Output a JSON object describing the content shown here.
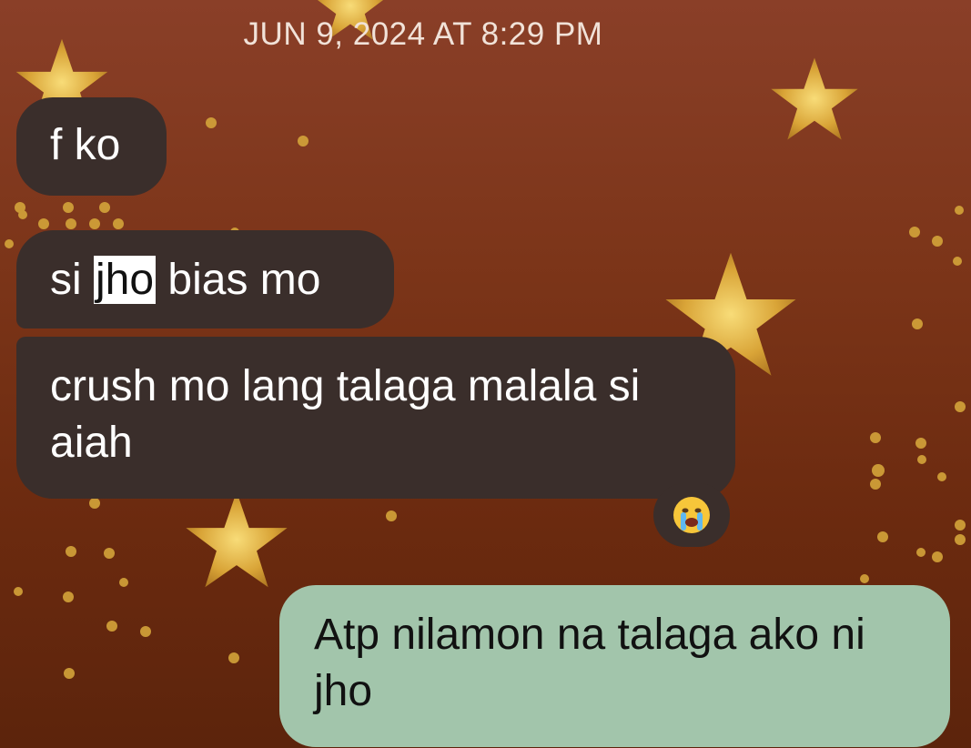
{
  "header": {
    "timestamp": "JUN 9, 2024 AT 8:29 PM"
  },
  "messages": [
    {
      "sender": "other",
      "parts": [
        "f ko"
      ]
    },
    {
      "sender": "other",
      "parts": [
        "si ",
        "jho",
        " bias mo"
      ],
      "highlighted_part": "jho"
    },
    {
      "sender": "other",
      "parts": [
        "crush mo lang talaga malala si aiah"
      ],
      "reaction": "crying-face-icon"
    },
    {
      "sender": "me",
      "parts": [
        "Atp nilamon na talaga ako ni jho"
      ]
    }
  ],
  "colors": {
    "background_top": "#8a3f28",
    "background_bottom": "#5c240c",
    "incoming_bubble": "#3a2e2b",
    "outgoing_bubble": "#a2c5ab",
    "highlight": "#ffffff",
    "sparkle": "#d4a43a"
  }
}
